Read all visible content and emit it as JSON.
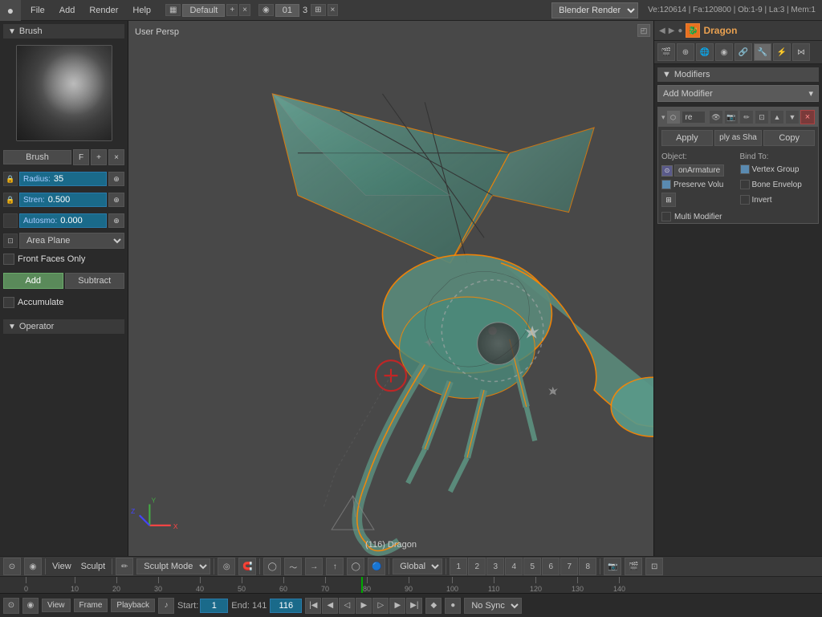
{
  "topbar": {
    "logo": "●",
    "menus": [
      "File",
      "Add",
      "Render",
      "Help"
    ],
    "layout_icon": "▦",
    "scene_name": "Default",
    "add_icon": "+",
    "close_icon": "×",
    "mode_icon": "◉",
    "frame_number": "01",
    "frame_separator": "3",
    "layer_icon": "⊞",
    "close2_icon": "×",
    "engine": "Blender Render",
    "stats": "Ve:120614 | Fa:120800 | Ob:1-9 | La:3 | Mem:1",
    "right_icons": [
      "⊙",
      "◻",
      "◯",
      "◉",
      "⊕",
      "♦",
      "🔧",
      "⚙",
      "▸"
    ]
  },
  "left_panel": {
    "brush_header": "Brush",
    "brush_name": "Brush",
    "brush_shortcut": "F",
    "brush_add_icon": "+",
    "brush_close_icon": "×",
    "radius_label": "Radius:",
    "radius_value": "35",
    "strength_label": "Stren:",
    "strength_value": "0.500",
    "autosmooth_label": "Autosmo:",
    "autosmooth_value": "0.000",
    "area_plane_label": "Area Plane",
    "front_faces_label": "Front Faces Only",
    "add_label": "Add",
    "subtract_label": "Subtract",
    "accumulate_label": "Accumulate",
    "operator_header": "Operator"
  },
  "viewport": {
    "label": "User Persp",
    "frame_label": "(116) Dragon",
    "corner_icon": "◰"
  },
  "right_panel": {
    "nav_icons": [
      "◉",
      "♦",
      "▸",
      "🐉",
      "◉"
    ],
    "object_name": "Dragon",
    "prop_icons": [
      "🔗",
      "⬡",
      "📷",
      "🎬",
      "🔧",
      "🎨",
      "🌐",
      "▲",
      "⚡"
    ],
    "modifiers_header": "Modifiers",
    "add_modifier_label": "Add Modifier",
    "add_modifier_icon": "▾",
    "modifier": {
      "arrow": "▾",
      "icon": "⬡",
      "re_label": "re",
      "icons": [
        "👁",
        "📷",
        "🔄",
        "▶",
        "📋"
      ],
      "apply_label": "Apply",
      "ply_sha_label": "ply as Sha",
      "copy_label": "Copy",
      "object_label": "Object:",
      "object_value": "onArmature",
      "bind_to_label": "Bind To:",
      "vertex_group_label": "Vertex Group",
      "preserve_vol_label": "Preserve Volu",
      "bone_envelop_label": "Bone Envelop",
      "grid_icon": "⊞",
      "invert_label": "Invert",
      "multi_modifier_label": "Multi Modifier"
    }
  },
  "bottom_toolbar": {
    "view_btn": "View",
    "sculpt_btn": "Sculpt",
    "mode_label": "Sculpt Mode",
    "mode_icon": "✏",
    "global_label": "Global",
    "icons": [
      "⊙",
      "◉",
      "⊕",
      "〜",
      "→",
      "↑",
      "◯",
      "🔵"
    ]
  },
  "timeline": {
    "ticks": [
      0,
      10,
      20,
      30,
      40,
      50,
      60,
      70,
      80,
      90,
      100,
      110,
      120,
      130,
      140
    ],
    "view_btn": "View",
    "frame_btn": "Frame",
    "playback_btn": "Playback",
    "audio_icon": "♪",
    "start_label": "Start:",
    "start_value": "1",
    "end_label": "End: 141",
    "current_frame": "116",
    "no_sync_label": "No Sync",
    "playback_icons": [
      "|◀",
      "◀◀",
      "◀",
      "▶",
      "▶▶",
      "▶|"
    ],
    "keyframe_icon": "◆"
  }
}
